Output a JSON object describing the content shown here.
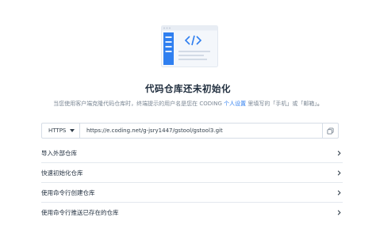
{
  "empty_state": {
    "title": "代码仓库还未初始化",
    "desc_prefix": "当您使用客户端克隆代码仓库时，终端提示的用户名是您在 CODING ",
    "desc_link": "个人设置",
    "desc_suffix": " 里填写的「手机」或「邮箱」",
    "desc_end": "。"
  },
  "clone": {
    "protocol": "HTTPS",
    "url": "https://e.coding.net/g-jsry1447/gstool/gstool3.git"
  },
  "options": [
    {
      "label": "导入外部仓库"
    },
    {
      "label": "快速初始化仓库"
    },
    {
      "label": "使用命令行创建仓库"
    },
    {
      "label": "使用命令行推送已存在的仓库"
    }
  ],
  "icons": {
    "illustration": "code-repo-illustration",
    "caret": "caret-down-icon",
    "copy": "copy-icon",
    "chevron": "chevron-right-icon"
  },
  "colors": {
    "accent": "#2f7ff0",
    "text": "#1f2d3d",
    "muted": "#7b8794"
  }
}
